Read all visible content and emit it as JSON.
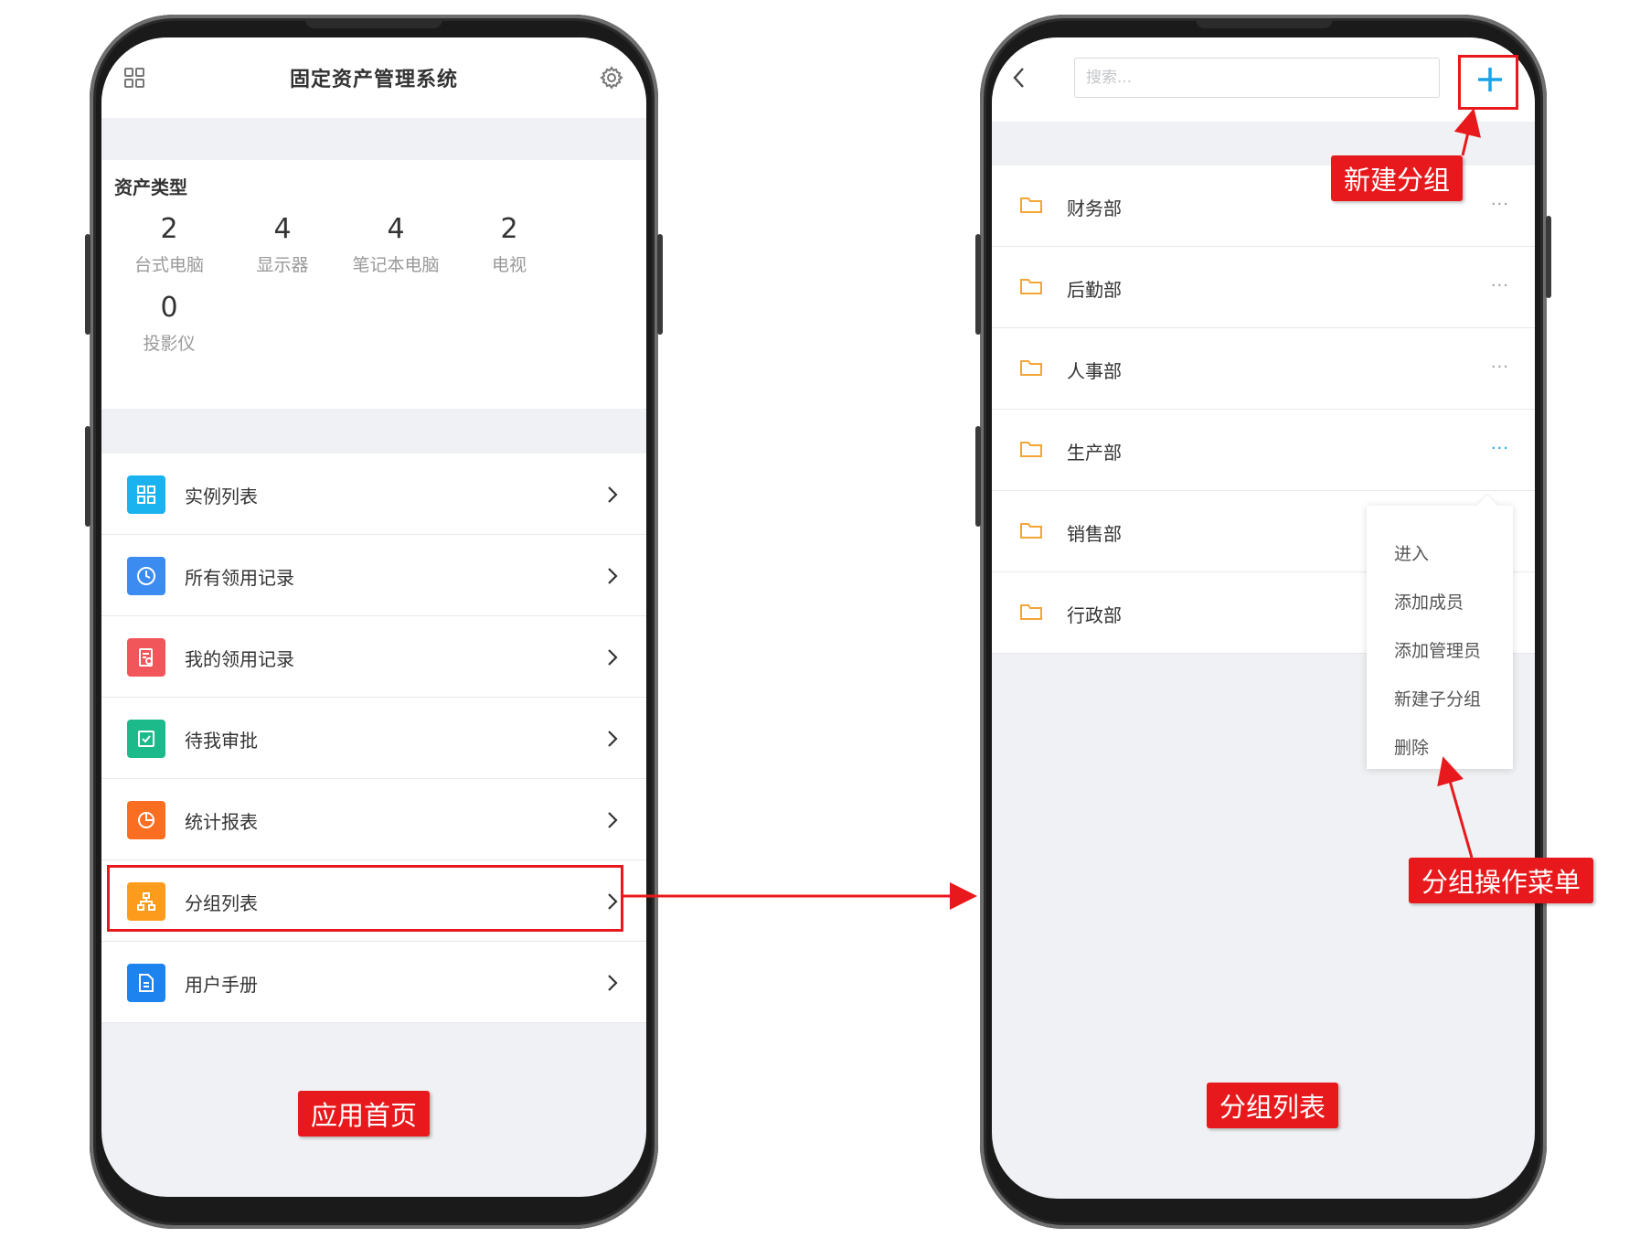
{
  "left_screen": {
    "title": "固定资产管理系统",
    "icons": {
      "top_left": "grid-icon",
      "top_right": "gear-icon"
    },
    "asset_types": {
      "heading": "资产类型",
      "items": [
        {
          "count": "2",
          "label": "台式电脑"
        },
        {
          "count": "4",
          "label": "显示器"
        },
        {
          "count": "4",
          "label": "笔记本电脑"
        },
        {
          "count": "2",
          "label": "电视"
        },
        {
          "count": "0",
          "label": "投影仪"
        }
      ]
    },
    "menu": [
      {
        "label": "实例列表",
        "icon": "grid-icon",
        "color": "#1ab2ef"
      },
      {
        "label": "所有领用记录",
        "icon": "clock-icon",
        "color": "#3b8bf0"
      },
      {
        "label": "我的领用记录",
        "icon": "record-icon",
        "color": "#f1565b"
      },
      {
        "label": "待我审批",
        "icon": "check-icon",
        "color": "#1cb98a"
      },
      {
        "label": "统计报表",
        "icon": "pie-chart-icon",
        "color": "#fa6e22"
      },
      {
        "label": "分组列表",
        "icon": "org-chart-icon",
        "color": "#fc9b1c"
      },
      {
        "label": "用户手册",
        "icon": "document-icon",
        "color": "#1d83ef"
      }
    ]
  },
  "right_screen": {
    "search_placeholder": "搜索...",
    "icons": {
      "back": "back-icon",
      "add": "plus-icon",
      "folder": "folder-icon",
      "more": "more-icon"
    },
    "groups": [
      {
        "name": "财务部"
      },
      {
        "name": "后勤部"
      },
      {
        "name": "人事部"
      },
      {
        "name": "生产部"
      },
      {
        "name": "销售部"
      },
      {
        "name": "行政部"
      }
    ],
    "more_glyph": "···",
    "active_group_index": 3,
    "popup_menu": [
      "进入",
      "添加成员",
      "添加管理员",
      "新建子分组",
      "删除"
    ]
  },
  "annotations": {
    "home": "应用首页",
    "group_list": "分组列表",
    "new_group": "新建分组",
    "group_menu": "分组操作菜单"
  },
  "colors": {
    "accent": "#1aa3e8",
    "annotation_red": "#e8191c",
    "folder": "#f3a535"
  }
}
